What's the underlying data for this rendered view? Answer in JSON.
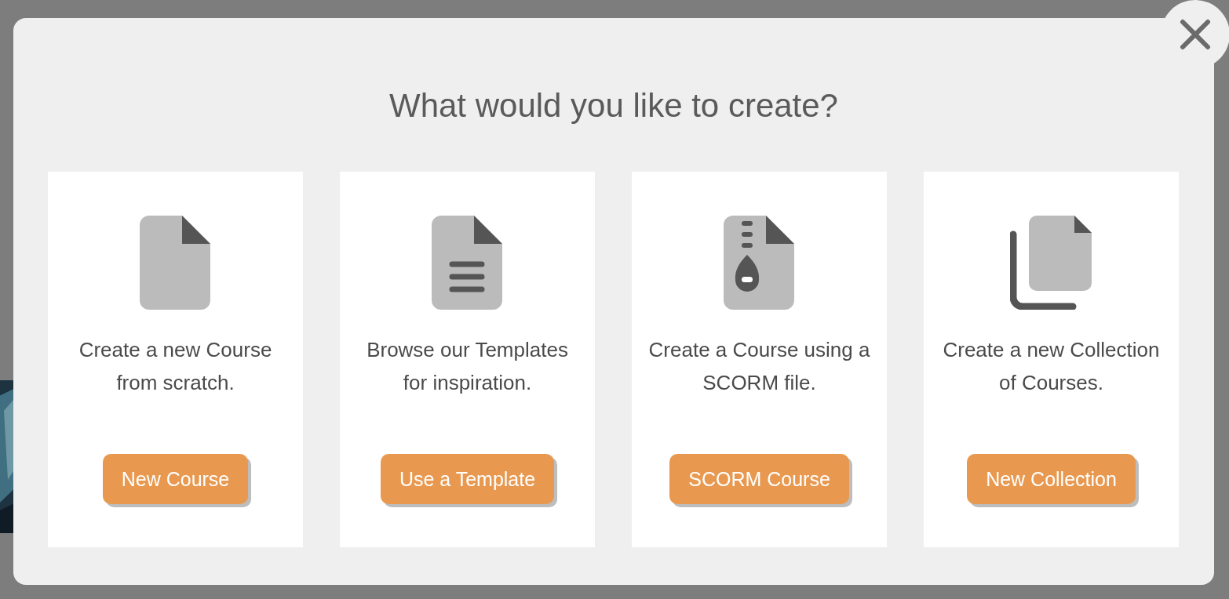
{
  "dialog": {
    "title": "What would you like to create?",
    "options": [
      {
        "kind": "blank",
        "description": "Create a new Course from scratch.",
        "button": "New Course"
      },
      {
        "kind": "template",
        "description": "Browse our Templates for inspiration.",
        "button": "Use a Template"
      },
      {
        "kind": "archive",
        "description": "Create a Course using a SCORM file.",
        "button": "SCORM Course"
      },
      {
        "kind": "collection",
        "description": "Create a new Collection of Courses.",
        "button": "New Collection"
      }
    ]
  }
}
